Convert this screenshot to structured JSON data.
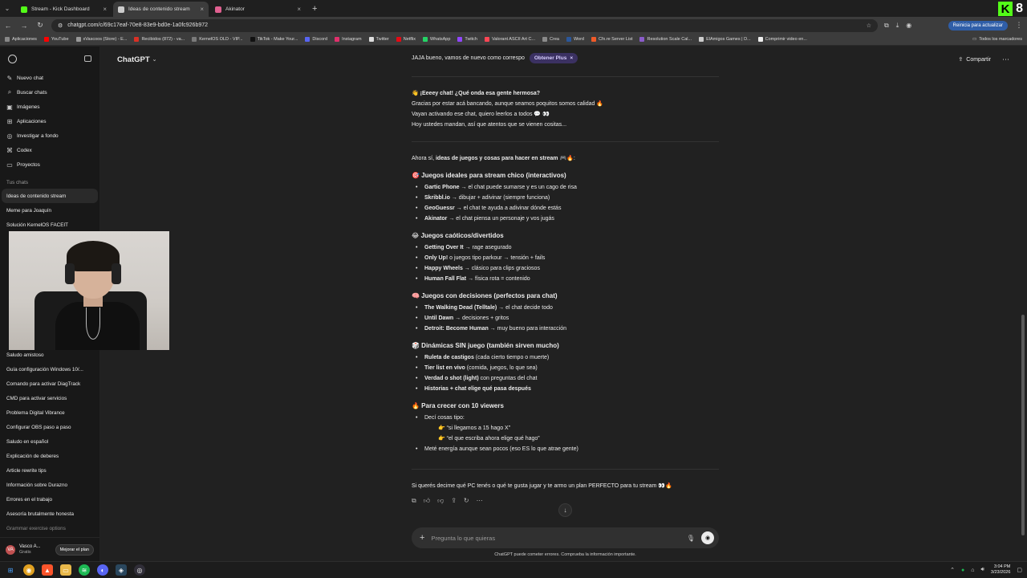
{
  "browser": {
    "tabs": [
      {
        "label": "Stream - Kick Dashboard",
        "color": "#53fc18",
        "active": false
      },
      {
        "label": "Ideas de contenido stream",
        "color": "#cccccc",
        "active": true
      },
      {
        "label": "Akinator",
        "color": "#e06090",
        "active": false
      }
    ],
    "url": "chatgpt.com/c/69c17eaf-70e8-83e9-bd0e-1a0fc926b972",
    "update_label": "Reinicia para actualizar",
    "kick_count": "8",
    "bookmarks": [
      {
        "label": "Aplicaciones",
        "color": "#888888"
      },
      {
        "label": "YouTube",
        "color": "#ff0000"
      },
      {
        "label": "xVascoos (Store) - E...",
        "color": "#999999"
      },
      {
        "label": "Recibidos (872) - va...",
        "color": "#d93025"
      },
      {
        "label": "KernelOS OLD - VIP...",
        "color": "#7a7a7a"
      },
      {
        "label": "TikTok - Make Your...",
        "color": "#111111"
      },
      {
        "label": "Discord",
        "color": "#5865f2"
      },
      {
        "label": "Instagram",
        "color": "#e1306c"
      },
      {
        "label": "Twitter",
        "color": "#dddddd"
      },
      {
        "label": "Netflix",
        "color": "#e50914"
      },
      {
        "label": "WhatsApp",
        "color": "#25d366"
      },
      {
        "label": "Twitch",
        "color": "#9146ff"
      },
      {
        "label": "Valorant ASCII Art C...",
        "color": "#ff4655"
      },
      {
        "label": "Crea",
        "color": "#8a8a8a"
      },
      {
        "label": "Word",
        "color": "#2b579a"
      },
      {
        "label": "Cfx.re Server List",
        "color": "#f05a28"
      },
      {
        "label": "Resolution Scale Cal...",
        "color": "#8a5cc9"
      },
      {
        "label": "ElAmigos Games | D...",
        "color": "#cccccc"
      },
      {
        "label": "Comprimir video en...",
        "color": "#eeeeee"
      }
    ],
    "bookmarks_all": "Todos los marcadores"
  },
  "sidebar": {
    "actions": [
      {
        "label": "Nuevo chat",
        "icon": "✎"
      },
      {
        "label": "Buscar chats",
        "icon": "⌕"
      },
      {
        "label": "Imágenes",
        "icon": "▣"
      },
      {
        "label": "Aplicaciones",
        "icon": "⊞"
      },
      {
        "label": "Investigar a fondo",
        "icon": "◎"
      },
      {
        "label": "Codex",
        "icon": "⌘"
      },
      {
        "label": "Proyectos",
        "icon": "▭"
      }
    ],
    "section_label": "Tus chats",
    "chats_top": [
      {
        "label": "Ideas de contenido stream",
        "active": true
      },
      {
        "label": "Meme para Joaquín",
        "active": false
      },
      {
        "label": "Solución KernelOS FACEIT",
        "active": false
      }
    ],
    "chats_bottom": [
      "Saludo amistoso",
      "Guía configuración Windows 10/...",
      "Comando para activar DiagTrack",
      "CMD para activar servicios",
      "Problema Digital Vibrance",
      "Configurar OBS paso a paso",
      "Saludo en español",
      "Explicación de deberes",
      "Article rewrite tips",
      "Información sobre Durazno",
      "Errores en el trabajo",
      "Asesoría brutalmente honesta",
      "Grammar exercise options"
    ],
    "user": {
      "name": "Vasco A...",
      "plan": "Gratis",
      "initials": "VA",
      "upgrade": "Mejorar el plan"
    }
  },
  "header": {
    "model": "ChatGPT",
    "share": "Compartir"
  },
  "prev_message": {
    "text": "JAJA bueno, vamos de nuevo como correspo",
    "plus_label": "Obtener Plus"
  },
  "greeting": {
    "title": "👋 ¡Eeeey chat! ¿Qué onda esa gente hermosa?",
    "lines": [
      "Gracias por estar acá bancando, aunque seamos poquitos somos calidad 🔥",
      "Vayan activando ese chat, quiero leerlos a todos 💬 👀",
      "Hoy ustedes mandan, así que atentos que se vienen cositas..."
    ]
  },
  "ideas": {
    "intro_plain": "Ahora sí, ",
    "intro_bold": "ideas de juegos y cosas para hacer en stream",
    "intro_tail": " 🎮🔥:",
    "sections": [
      {
        "title": "🎯 Juegos ideales para stream chico (interactivos)",
        "items": [
          {
            "bold": "Gartic Phone",
            "rest": " → el chat puede sumarse y es un cago de risa"
          },
          {
            "bold": "Skribbl.io",
            "rest": " → dibujar + adivinar (siempre funciona)"
          },
          {
            "bold": "GeoGuessr",
            "rest": " → el chat te ayuda a adivinar dónde estás"
          },
          {
            "bold": "Akinator",
            "rest": " → el chat piensa un personaje y vos jugás"
          }
        ]
      },
      {
        "title": "😂 Juegos caóticos/divertidos",
        "items": [
          {
            "bold": "Getting Over It",
            "rest": " → rage asegurado"
          },
          {
            "bold": "Only Up!",
            "rest": " o juegos tipo parkour → tensión + fails"
          },
          {
            "bold": "Happy Wheels",
            "rest": " → clásico para clips graciosos"
          },
          {
            "bold": "Human Fall Flat",
            "rest": " → física rota = contenido"
          }
        ]
      },
      {
        "title": "🧠 Juegos con decisiones (perfectos para chat)",
        "items": [
          {
            "bold": "The Walking Dead (Telltale)",
            "rest": " → el chat decide todo"
          },
          {
            "bold": "Until Dawn",
            "rest": " → decisiones + gritos"
          },
          {
            "bold": "Detroit: Become Human",
            "rest": " → muy bueno para interacción"
          }
        ]
      },
      {
        "title": "🎲 Dinámicas SIN juego (también sirven mucho)",
        "items": [
          {
            "bold": "Ruleta de castigos",
            "rest": " (cada cierto tiempo o muerte)"
          },
          {
            "bold": "Tier list en vivo",
            "rest": " (comida, juegos, lo que sea)"
          },
          {
            "bold": "Verdad o shot (light)",
            "rest": " con preguntas del chat"
          },
          {
            "bold": "Historias + chat elige qué pasa después",
            "rest": ""
          }
        ]
      }
    ],
    "grow": {
      "title": "🔥 Para crecer con 10 viewers",
      "item1": "Decí cosas tipo:",
      "sub1": "👉 “si llegamos a 15 hago X”",
      "sub2": "👉 “el que escriba ahora elige qué hago”",
      "item2": "Meté energía aunque sean pocos (eso ES lo que atrae gente)"
    },
    "closing": "Si querés decime qué PC tenés o qué te gusta jugar y te armo un plan PERFECTO para tu stream 👀🔥"
  },
  "composer": {
    "placeholder": "Pregunta lo que quieras",
    "value": ""
  },
  "disclaimer": "ChatGPT puede cometer errores. Comprueba la información importante.",
  "taskbar": {
    "time": "3:04 PM",
    "date": "3/23/2026"
  }
}
